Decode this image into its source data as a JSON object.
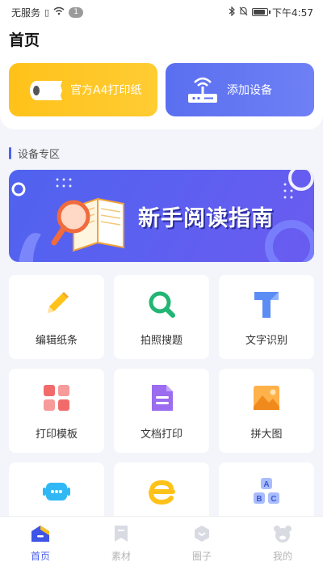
{
  "status_bar": {
    "carrier": "无服务",
    "notification_count": "1",
    "time": "下午4:57",
    "battery_level": 0.8
  },
  "header": {
    "title": "首页"
  },
  "hero_cards": [
    {
      "label": "官方A4打印纸",
      "icon": "paper-roll-icon"
    },
    {
      "label": "添加设备",
      "icon": "router-icon"
    }
  ],
  "section": {
    "title": "设备专区"
  },
  "banner": {
    "text": "新手阅读指南"
  },
  "tools": [
    {
      "label": "编辑纸条",
      "icon": "pencil-icon"
    },
    {
      "label": "拍照搜题",
      "icon": "search-icon"
    },
    {
      "label": "文字识别",
      "icon": "text-recognition-icon"
    },
    {
      "label": "打印模板",
      "icon": "template-icon"
    },
    {
      "label": "文档打印",
      "icon": "document-icon"
    },
    {
      "label": "拼大图",
      "icon": "image-icon"
    },
    {
      "label": "",
      "icon": "robot-icon"
    },
    {
      "label": "",
      "icon": "e-icon"
    },
    {
      "label": "",
      "icon": "abc-blocks-icon"
    }
  ],
  "tabs": [
    {
      "label": "首页",
      "icon": "home-icon",
      "active": true
    },
    {
      "label": "素材",
      "icon": "bookmark-icon",
      "active": false
    },
    {
      "label": "圈子",
      "icon": "hexagon-icon",
      "active": false
    },
    {
      "label": "我的",
      "icon": "bear-icon",
      "active": false
    }
  ],
  "colors": {
    "accent": "#4d62ee",
    "yellow_card": "#ffc21a",
    "blue_card": "#5a6ff0"
  }
}
